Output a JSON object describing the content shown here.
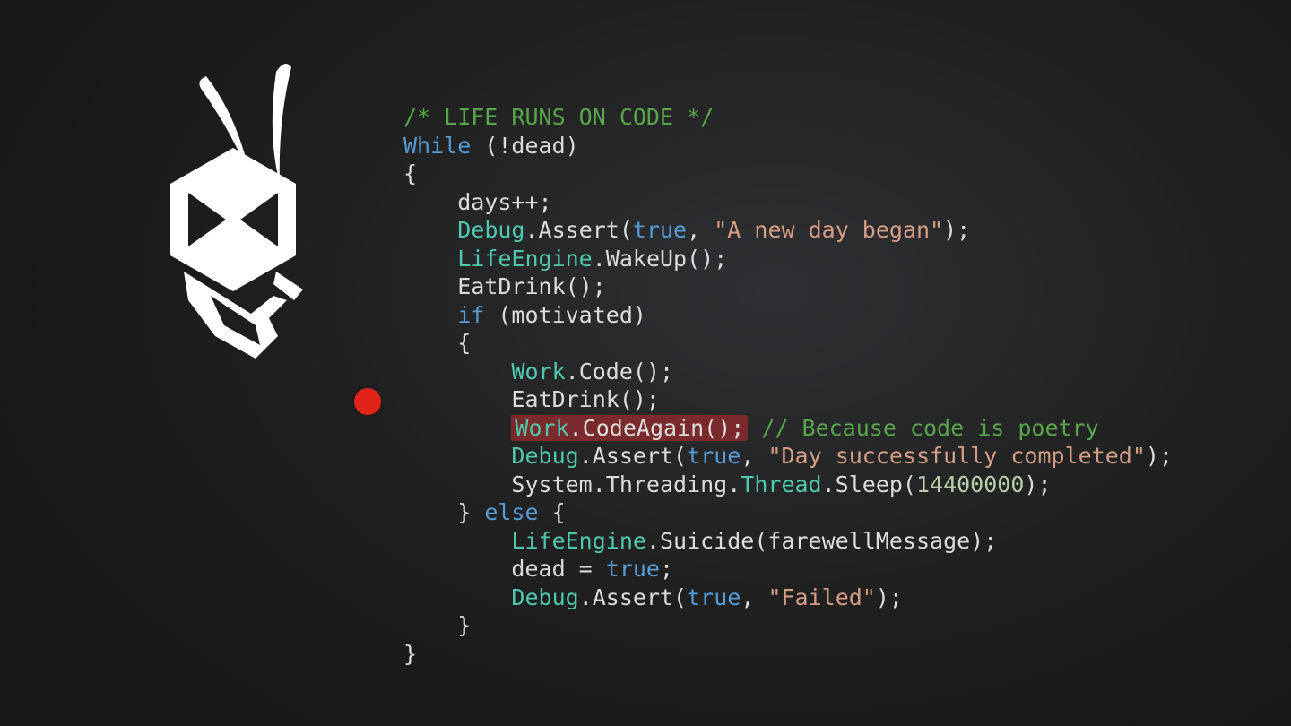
{
  "colors": {
    "comment": "#57a64a",
    "keyword": "#569cd6",
    "type": "#4ec9b0",
    "string": "#d69d85",
    "number": "#b5cea8",
    "plain": "#dcdcdc",
    "bp_bg": "#7a2a2a",
    "bp_dot": "#e2231a"
  },
  "tokens": {
    "t0": "/* LIFE RUNS ON CODE */",
    "t1": "While",
    "t2": " (!dead)",
    "t3": "{",
    "t4": "    days++;",
    "t5a": "    ",
    "t5b": "Debug",
    "t5c": ".Assert(",
    "t5d": "true",
    "t5e": ", ",
    "t5f": "\"A new day began\"",
    "t5g": ");",
    "t6a": "    ",
    "t6b": "LifeEngine",
    "t6c": ".WakeUp();",
    "t7": "    EatDrink();",
    "t8a": "    ",
    "t8b": "if",
    "t8c": " (motivated)",
    "t9": "    {",
    "t10a": "        ",
    "t10b": "Work",
    "t10c": ".Code();",
    "t11": "        EatDrink();",
    "t12a": "        ",
    "t12b_work": "Work",
    "t12b_rest": ".CodeAgain();",
    "t12c": " ",
    "t12d": "// Because code is poetry",
    "t13a": "        ",
    "t13b": "Debug",
    "t13c": ".Assert(",
    "t13d": "true",
    "t13e": ", ",
    "t13f": "\"Day successfully completed\"",
    "t13g": ");",
    "t14a": "        System.Threading.",
    "t14b": "Thread",
    "t14c": ".Sleep(",
    "t14d": "14400000",
    "t14e": ");",
    "t15a": "    } ",
    "t15b": "else",
    "t15c": " {",
    "t16a": "        ",
    "t16b": "LifeEngine",
    "t16c": ".Suicide(farewellMessage);",
    "t17a": "        dead = ",
    "t17b": "true",
    "t17c": ";",
    "t18a": "        ",
    "t18b": "Debug",
    "t18c": ".Assert(",
    "t18d": "true",
    "t18e": ", ",
    "t18f": "\"Failed\"",
    "t18g": ");",
    "t19": "    }",
    "t20": "}"
  },
  "code_text": "/* LIFE RUNS ON CODE */\nWhile (!dead)\n{\n    days++;\n    Debug.Assert(true, \"A new day began\");\n    LifeEngine.WakeUp();\n    EatDrink();\n    if (motivated)\n    {\n        Work.Code();\n        EatDrink();\n        Work.CodeAgain(); // Because code is poetry\n        Debug.Assert(true, \"Day successfully completed\");\n        System.Threading.Thread.Sleep(14400000);\n    } else {\n        LifeEngine.Suicide(farewellMessage);\n        dead = true;\n        Debug.Assert(true, \"Failed\");\n    }\n}"
}
